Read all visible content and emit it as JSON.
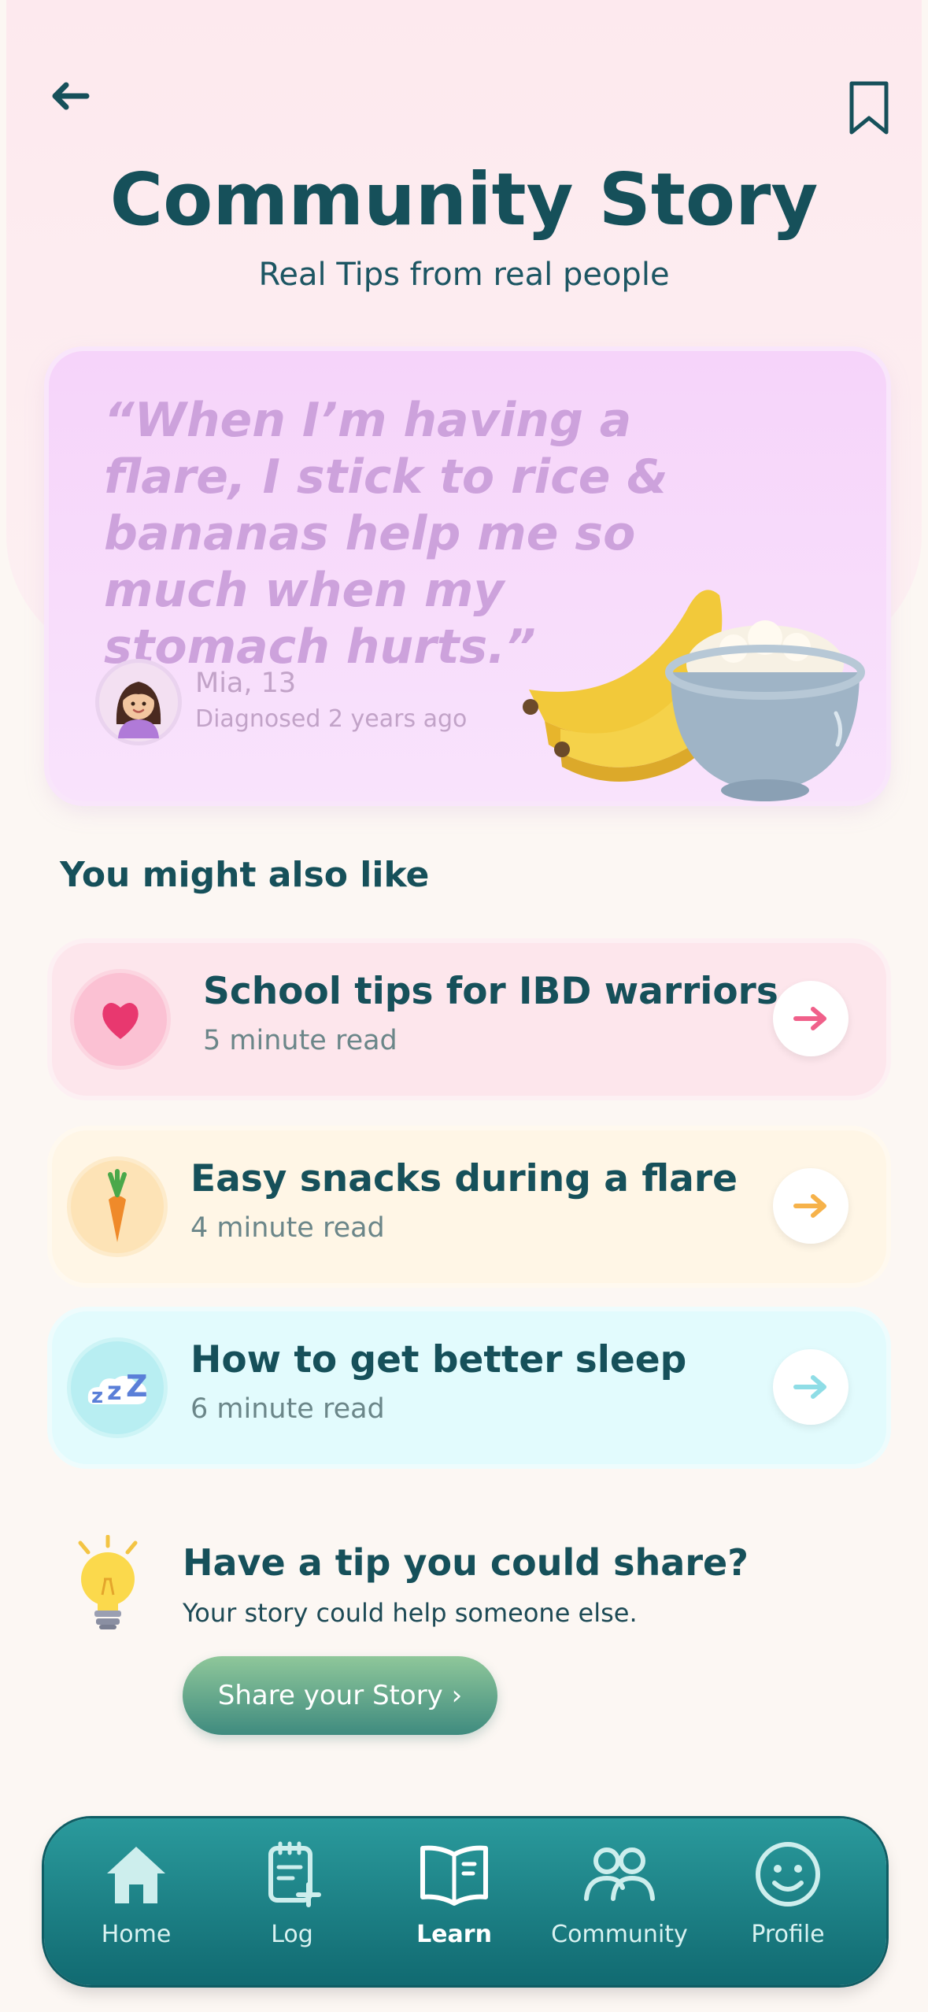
{
  "header": {
    "title": "Community Story",
    "subtitle": "Real Tips from real people"
  },
  "story": {
    "quote": "“When I’m having a flare, I stick to rice & bananas help me so much when my stomach hurts.”",
    "author_name": "Mia, 13",
    "author_meta": "Diagnosed 2 years ago"
  },
  "related": {
    "heading": "You might also like",
    "items": [
      {
        "title": "School tips for IBD warriors",
        "subtitle": "5 minute read",
        "icon": "heart-icon",
        "accent": "#f0608a"
      },
      {
        "title": "Easy snacks during a flare",
        "subtitle": "4 minute read",
        "icon": "carrot-icon",
        "accent": "#f6b24a"
      },
      {
        "title": "How to get better sleep",
        "subtitle": "6 minute read",
        "icon": "sleep-cloud-icon",
        "accent": "#8fdde6"
      }
    ]
  },
  "share": {
    "heading": "Have a tip you could share?",
    "subtitle": "Your story could help someone else.",
    "button_label": "Share your Story ›"
  },
  "nav": {
    "items": [
      {
        "label": "Home",
        "icon": "home-icon"
      },
      {
        "label": "Log",
        "icon": "log-icon"
      },
      {
        "label": "Learn",
        "icon": "book-icon",
        "active": true
      },
      {
        "label": "Community",
        "icon": "people-icon"
      },
      {
        "label": "Profile",
        "icon": "smiley-icon"
      }
    ]
  },
  "colors": {
    "primary": "#16505a",
    "nav_bg": "#1e8389",
    "quote_card": "#f6d4fa",
    "share_button": "#5fa98a"
  }
}
